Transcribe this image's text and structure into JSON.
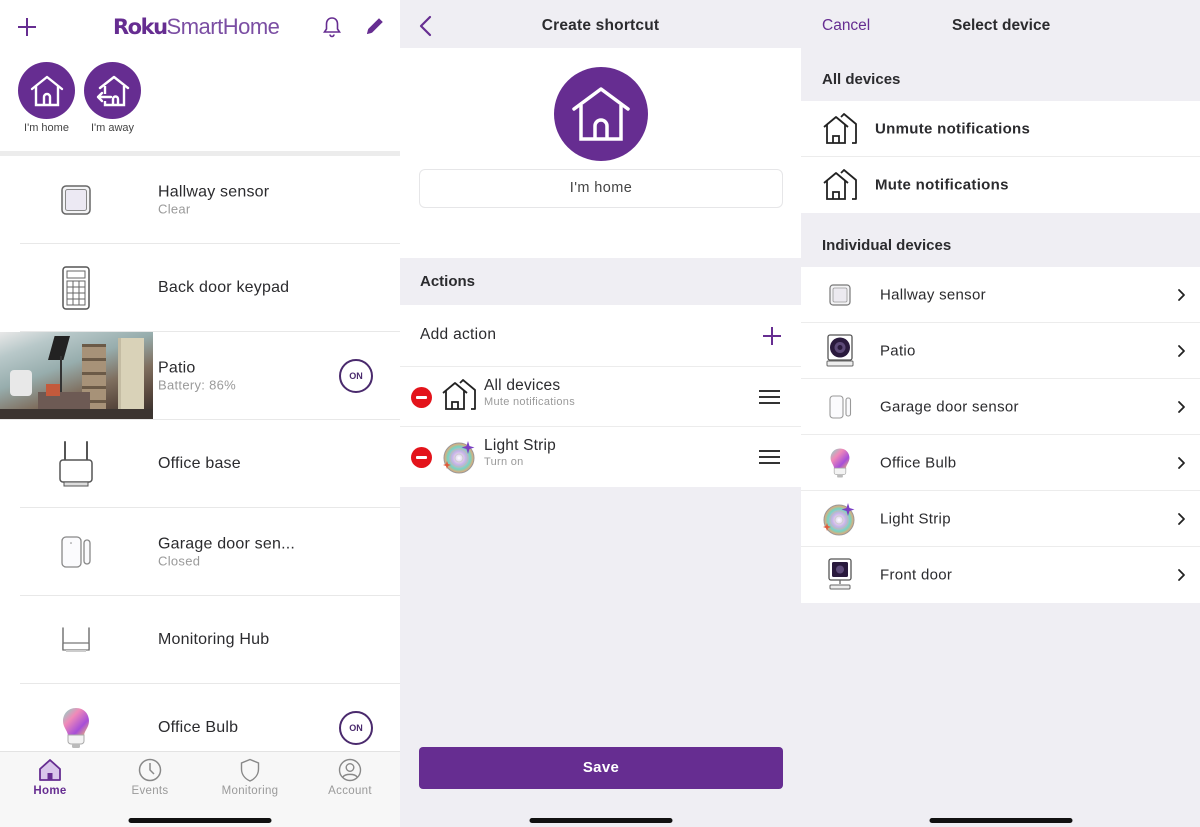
{
  "colors": {
    "brand": "#662d91",
    "danger": "#e3141b",
    "bg_gray": "#efeef3"
  },
  "screen1": {
    "logo_bold": "Roku",
    "logo_light": "SmartHome",
    "header_icons": [
      "plus-icon",
      "bell-icon",
      "pencil-icon"
    ],
    "shortcuts": [
      {
        "label": "I'm home",
        "icon": "house-icon"
      },
      {
        "label": "I'm away",
        "icon": "house-leaving-icon"
      }
    ],
    "devices": [
      {
        "name": "Hallway sensor",
        "status": "Clear",
        "icon": "motion-sensor-icon"
      },
      {
        "name": "Back door keypad",
        "status": "",
        "icon": "keypad-icon"
      },
      {
        "name": "Patio",
        "status": "Battery: 86%",
        "icon": "camera-thumbnail",
        "toggle": "ON"
      },
      {
        "name": "Office base",
        "status": "",
        "icon": "base-station-icon"
      },
      {
        "name": "Garage door sen...",
        "status": "Closed",
        "icon": "contact-sensor-icon"
      },
      {
        "name": "Monitoring Hub",
        "status": "",
        "icon": "hub-icon"
      },
      {
        "name": "Office Bulb",
        "status": "",
        "icon": "bulb-icon",
        "toggle": "ON"
      }
    ],
    "tabs": [
      {
        "label": "Home",
        "icon": "home-icon",
        "active": true
      },
      {
        "label": "Events",
        "icon": "clock-icon",
        "active": false
      },
      {
        "label": "Monitoring",
        "icon": "shield-icon",
        "active": false
      },
      {
        "label": "Account",
        "icon": "account-icon",
        "active": false
      }
    ]
  },
  "screen2": {
    "title": "Create shortcut",
    "shortcut_name": "I'm home",
    "actions_header": "Actions",
    "add_action_label": "Add action",
    "actions": [
      {
        "name": "All devices",
        "detail": "Mute notifications",
        "icon": "all-devices-icon"
      },
      {
        "name": "Light Strip",
        "detail": "Turn on",
        "icon": "light-strip-icon"
      }
    ],
    "save_label": "Save"
  },
  "screen3": {
    "cancel_label": "Cancel",
    "title": "Select device",
    "all_devices_header": "All devices",
    "all_devices": [
      {
        "label": "Unmute notifications",
        "icon": "all-devices-icon"
      },
      {
        "label": "Mute notifications",
        "icon": "all-devices-icon"
      }
    ],
    "individual_header": "Individual devices",
    "individual": [
      {
        "label": "Hallway sensor",
        "icon": "motion-sensor-icon"
      },
      {
        "label": "Patio",
        "icon": "camera-icon"
      },
      {
        "label": "Garage door sensor",
        "icon": "contact-sensor-icon"
      },
      {
        "label": "Office Bulb",
        "icon": "bulb-icon"
      },
      {
        "label": "Light Strip",
        "icon": "light-strip-icon"
      },
      {
        "label": "Front door",
        "icon": "camera-icon"
      }
    ]
  }
}
